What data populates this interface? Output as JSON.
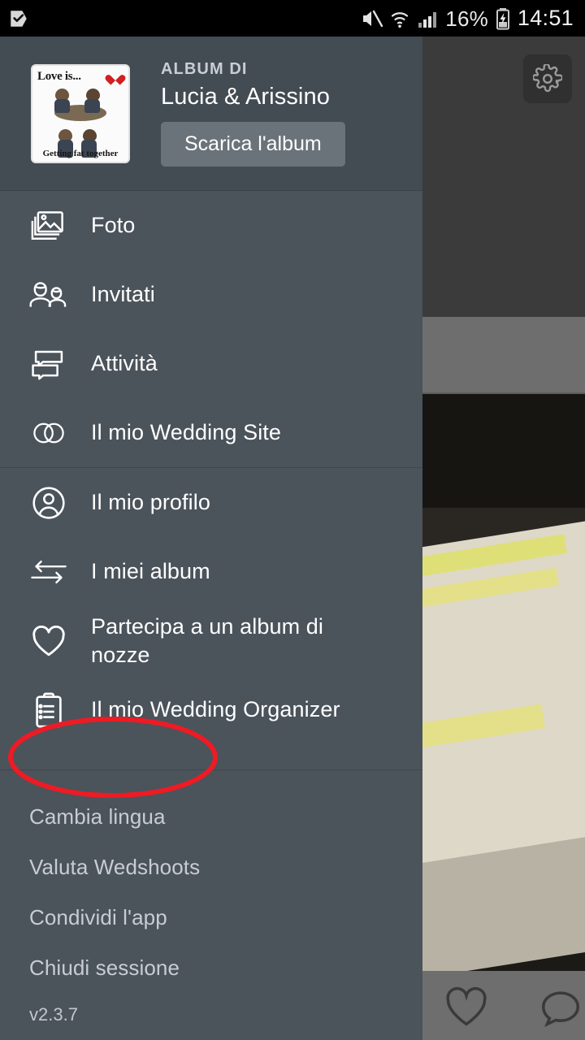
{
  "statusbar": {
    "left_icon": "app-notification-icon",
    "icons": [
      "mute-icon",
      "wifi-icon",
      "signal-icon"
    ],
    "battery_percent": "16%",
    "battery_state": "charging",
    "clock": "14:51"
  },
  "drawer": {
    "header": {
      "kicker": "ALBUM DI",
      "title": "Lucia & Arissino",
      "download_label": "Scarica l'album",
      "thumbnail": {
        "title_text": "Love is...",
        "caption_text": "Getting fat together",
        "heart_color": "#d02020"
      }
    },
    "groups": [
      {
        "items": [
          {
            "icon": "photos-icon",
            "label": "Foto"
          },
          {
            "icon": "guests-icon",
            "label": "Invitati"
          },
          {
            "icon": "activity-icon",
            "label": "Attività"
          },
          {
            "icon": "rings-icon",
            "label": "Il mio Wedding Site"
          }
        ]
      },
      {
        "items": [
          {
            "icon": "profile-icon",
            "label": "Il mio profilo"
          },
          {
            "icon": "swap-arrows-icon",
            "label": "I miei album"
          },
          {
            "icon": "heart-icon",
            "label": "Partecipa a un album di nozze"
          },
          {
            "icon": "clipboard-icon",
            "label": "Il mio Wedding Organizer"
          }
        ]
      }
    ],
    "footer": {
      "items": [
        {
          "label": "Cambia lingua"
        },
        {
          "label": "Valuta Wedshoots"
        },
        {
          "label": "Condividi l'app"
        },
        {
          "label": "Chiudi sessione"
        }
      ],
      "version": "v2.3.7"
    }
  },
  "background": {
    "gear_icon": "gear-icon",
    "tab_icon": "guests-icon",
    "bottom_icons": [
      "heart-icon",
      "comment-icon"
    ]
  },
  "annotation": {
    "shape": "ellipse",
    "color": "#ed1b24",
    "stroke_width": 6,
    "targets": "Cambia lingua"
  },
  "colors": {
    "drawer_bg": "#4b535b",
    "drawer_header_bg": "#434b53",
    "button_bg": "#6b737a",
    "text_primary": "#ffffff",
    "text_secondary": "#c8cdd2",
    "statusbar_bg": "#000000",
    "annotation_red": "#ed1b24"
  }
}
